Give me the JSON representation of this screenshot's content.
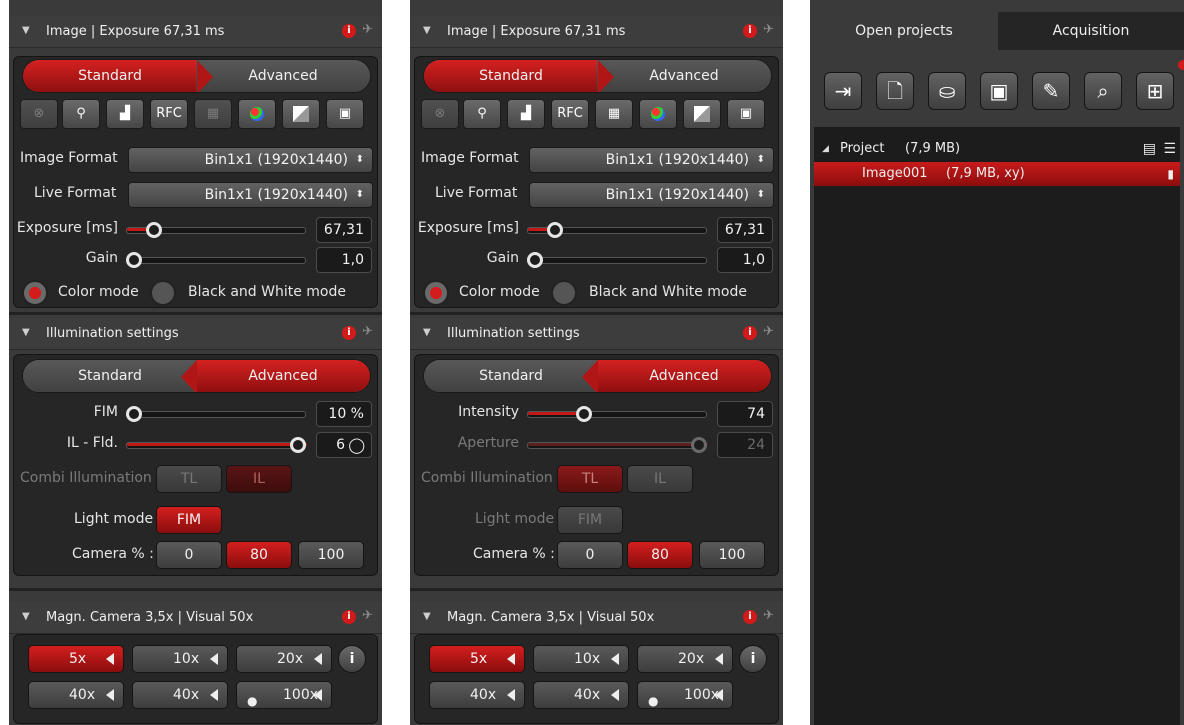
{
  "panels": [
    {
      "image_section": {
        "title": "Image | Exposure 67,31 ms",
        "mode_standard": "Standard",
        "mode_advanced": "Advanced",
        "active_mode": "Standard",
        "toolbar": [
          "no-entry-icon",
          "zoom-all-icon",
          "histogram-icon",
          "RFC",
          "grid-icon",
          "color-balls-icon",
          "white-balance-icon",
          "add-image-icon"
        ],
        "rfc_label": "RFC",
        "image_format_label": "Image Format",
        "image_format_value": "Bin1x1 (1920x1440)",
        "live_format_label": "Live Format",
        "live_format_value": "Bin1x1 (1920x1440)",
        "exposure_label": "Exposure [ms]",
        "exposure_value": "67,31",
        "exposure_level": 0.12,
        "gain_label": "Gain",
        "gain_value": "1,0",
        "gain_level": 0.0,
        "color_mode_label": "Color mode",
        "bw_mode_label": "Black and White mode",
        "selected_color_mode": "Color mode"
      },
      "illumination_section": {
        "title": "Illumination settings",
        "mode_standard": "Standard",
        "mode_advanced": "Advanced",
        "active_mode": "Advanced",
        "slider1_label": "FIM",
        "slider1_value": "10 %",
        "slider1_level": 0.0,
        "slider1_dim": false,
        "slider2_label": "IL - Fld.",
        "slider2_value": "6",
        "slider2_level": 1.0,
        "slider2_dim": false,
        "combi_label": "Combi Illumination",
        "tl_label": "TL",
        "il_label": "IL",
        "light_mode_label": "Light mode",
        "light_mode_value": "FIM",
        "camera_label": "Camera % :",
        "camera_options": [
          "0",
          "80",
          "100"
        ],
        "camera_selected": "80"
      },
      "magnification_section": {
        "title": "Magn.  Camera 3,5x | Visual 50x",
        "buttons": [
          "5x",
          "10x",
          "20x",
          "40x",
          "40x",
          "100x"
        ],
        "selected": "5x",
        "info_label": "i"
      }
    },
    {
      "image_section": {
        "title": "Image | Exposure 67,31 ms",
        "mode_standard": "Standard",
        "mode_advanced": "Advanced",
        "active_mode": "Standard",
        "rfc_label": "RFC",
        "image_format_label": "Image Format",
        "image_format_value": "Bin1x1 (1920x1440)",
        "live_format_label": "Live Format",
        "live_format_value": "Bin1x1 (1920x1440)",
        "exposure_label": "Exposure [ms]",
        "exposure_value": "67,31",
        "exposure_level": 0.12,
        "gain_label": "Gain",
        "gain_value": "1,0",
        "gain_level": 0.0,
        "color_mode_label": "Color mode",
        "bw_mode_label": "Black and White mode",
        "selected_color_mode": "Color mode"
      },
      "illumination_section": {
        "title": "Illumination settings",
        "mode_standard": "Standard",
        "mode_advanced": "Advanced",
        "active_mode": "Advanced",
        "slider1_label": "Intensity",
        "slider1_value": "74",
        "slider1_level": 0.3,
        "slider1_dim": false,
        "slider2_label": "Aperture",
        "slider2_value": "24",
        "slider2_level": 1.0,
        "slider2_dim": true,
        "combi_label": "Combi Illumination",
        "tl_label": "TL",
        "il_label": "IL",
        "light_mode_label": "Light mode",
        "light_mode_value": "FIM",
        "camera_label": "Camera % :",
        "camera_options": [
          "0",
          "80",
          "100"
        ],
        "camera_selected": "80"
      },
      "magnification_section": {
        "title": "Magn.  Camera 3,5x | Visual 50x",
        "buttons": [
          "5x",
          "10x",
          "20x",
          "40x",
          "40x",
          "100x"
        ],
        "selected": "5x",
        "info_label": "i"
      }
    }
  ],
  "projects": {
    "tabs": [
      "Open projects",
      "Acquisition"
    ],
    "active_tab": "Open projects",
    "toolbar_icons": [
      "export-icon",
      "new-document-icon",
      "open-folder-icon",
      "save-icon",
      "edit-document-icon",
      "find-document-icon",
      "layout-grid-icon"
    ],
    "tree": [
      {
        "label": "Project",
        "size": "(7,9 MB)",
        "level": 0,
        "selected": false
      },
      {
        "label": "Image001",
        "size": "(7,9 MB, xy)",
        "level": 1,
        "selected": true
      }
    ]
  },
  "colors": {
    "accent_red": "#c31818",
    "panel_bg": "#3a3a3a",
    "inner_bg": "#262626"
  }
}
